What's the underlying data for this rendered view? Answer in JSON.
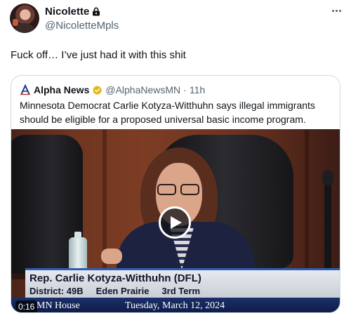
{
  "tweet": {
    "author": {
      "display_name": "Nicolette",
      "handle": "@NicoletteMpls",
      "avatar_icon": "avatar-photo",
      "protected_icon": "lock-icon"
    },
    "more_icon": "more-options-icon",
    "text": "Fuck off… I’ve just had it with this shit"
  },
  "quoted_tweet": {
    "logo_icon": "alpha-news-logo",
    "author_name": "Alpha News",
    "verified_icon": "gold-verified-badge",
    "handle": "@AlphaNewsMN",
    "separator": "·",
    "time": "11h",
    "text": "Minnesota Democrat Carlie Kotyza-Witthuhn says illegal immigrants should be eligible for a proposed universal basic income program.",
    "video": {
      "play_icon": "play-icon",
      "timestamp": "0:16",
      "lower_third": {
        "name": "Rep. Carlie Kotyza-Witthuhn (DFL)",
        "district": "District: 49B",
        "city": "Eden Prairie",
        "term": "3rd Term"
      },
      "ticker": {
        "left": "MN House",
        "date": "Tuesday, March 12, 2024"
      }
    }
  },
  "colors": {
    "text_primary": "#0f1419",
    "text_secondary": "#536471",
    "border": "#cfd9de",
    "verified_gold": "#e2b719",
    "lower_third_accent": "#2d5cb0"
  }
}
